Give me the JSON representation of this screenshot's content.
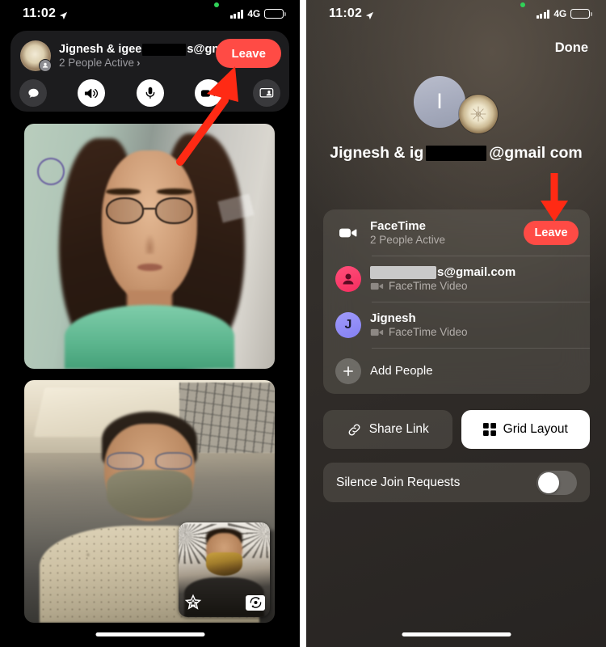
{
  "status_bar": {
    "time": "11:02",
    "network": "4G",
    "location_icon": "location-arrow-icon",
    "signal_icon": "cellular-signal-icon",
    "battery_icon": "battery-icon",
    "recording_indicator": "green-privacy-dot"
  },
  "left_phone": {
    "call_header": {
      "title_prefix": "Jignesh & igee",
      "title_suffix": "s@gmail.c...",
      "subtitle": "2 People Active",
      "chevron": "›",
      "avatar_icon": "group-avatar-sand-dollar",
      "avatar_badge_icon": "person-badge-icon",
      "leave_label": "Leave",
      "leave_color": "#FF4B45"
    },
    "controls": [
      {
        "name": "messages-button",
        "icon": "chat-bubble-icon",
        "state": "off"
      },
      {
        "name": "speaker-button",
        "icon": "speaker-wave-icon",
        "state": "on"
      },
      {
        "name": "microphone-button",
        "icon": "microphone-icon",
        "state": "on"
      },
      {
        "name": "camera-button",
        "icon": "video-camera-icon",
        "state": "on"
      },
      {
        "name": "share-screen-button",
        "icon": "share-screen-icon",
        "state": "off"
      }
    ],
    "tiles": [
      {
        "name": "participant-video-top",
        "label": ""
      },
      {
        "name": "participant-video-bottom",
        "label": ""
      }
    ],
    "pip": {
      "name": "self-view-pip",
      "effects_icon": "effects-star-icon",
      "flip_icon": "camera-flip-icon"
    }
  },
  "right_phone": {
    "done_label": "Done",
    "avatar_initial": "I",
    "avatar_photo_icon": "sand-dollar-avatar",
    "title_prefix": "Jignesh & ig",
    "title_suffix": "@gmail com",
    "facetime_row": {
      "icon": "video-camera-icon",
      "title": "FaceTime",
      "subtitle": "2 People Active",
      "leave_label": "Leave",
      "leave_color": "#FF4B45"
    },
    "participants": [
      {
        "avatar_icon": "person-circle-icon",
        "avatar_color": "#FF3B6B",
        "name_prefix": "",
        "name_suffix": "s@gmail.com",
        "status_icon": "facetime-video-icon",
        "status": "FaceTime Video",
        "redacted": true
      },
      {
        "avatar_icon": "initial-avatar",
        "avatar_color": "#8E8BF5",
        "avatar_initial": "J",
        "name_prefix": "Jignesh",
        "name_suffix": "",
        "status_icon": "facetime-video-icon",
        "status": "FaceTime Video",
        "redacted": false
      }
    ],
    "add_people": {
      "icon": "plus-icon",
      "label": "Add People"
    },
    "buttons": [
      {
        "name": "share-link-button",
        "icon": "link-icon",
        "label": "Share Link",
        "style": "dark"
      },
      {
        "name": "grid-layout-button",
        "icon": "grid-icon",
        "label": "Grid Layout",
        "style": "light"
      }
    ],
    "silence": {
      "label": "Silence Join Requests",
      "toggle_state": "off"
    }
  },
  "annotations": [
    {
      "name": "arrow-to-leave-button-left",
      "color": "#FF2A14",
      "direction": "up-right"
    },
    {
      "name": "arrow-to-leave-button-right",
      "color": "#FF2A14",
      "direction": "down"
    }
  ]
}
